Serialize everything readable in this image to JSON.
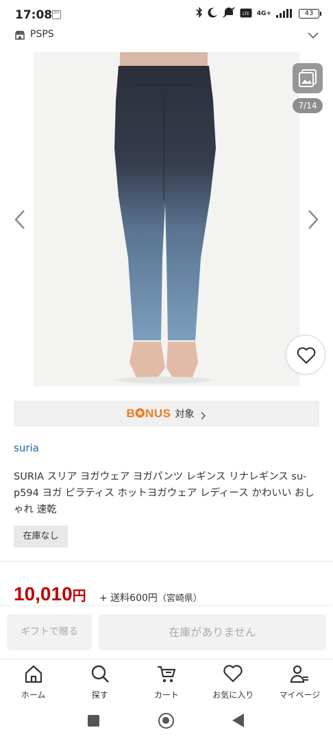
{
  "status_bar": {
    "time": "17:08",
    "battery": "43",
    "network": "4G+",
    "chip_label": "BOX"
  },
  "store": {
    "name": "PSPS"
  },
  "gallery": {
    "counter": "7/14",
    "image_desc_icon": "gallery-icon"
  },
  "bonus": {
    "logo": "B✪NUS",
    "label": "対象"
  },
  "product": {
    "shop": "suria",
    "title": "SURIA スリア ヨガウェア ヨガパンツ レギンス リナレギンス su-p594 ヨガ ピラティス ホットヨガウェア レディース かわいい おしゃれ 速乾",
    "stock_badge": "在庫なし",
    "price": "10,010",
    "price_unit": "円",
    "shipping_label": "+ 送料600円",
    "shipping_region": "（宮崎県）"
  },
  "actions": {
    "gift": "ギフトで贈る",
    "no_stock": "在庫がありません"
  },
  "bottom_nav": [
    {
      "label": "ホーム",
      "icon": "home-icon"
    },
    {
      "label": "探す",
      "icon": "search-icon"
    },
    {
      "label": "カート",
      "icon": "cart-icon"
    },
    {
      "label": "お気に入り",
      "icon": "heart-icon"
    },
    {
      "label": "マイページ",
      "icon": "user-icon"
    }
  ],
  "colors": {
    "price": "#bf0000",
    "bonus": "#ec7b1c",
    "link": "#1a67b5"
  }
}
